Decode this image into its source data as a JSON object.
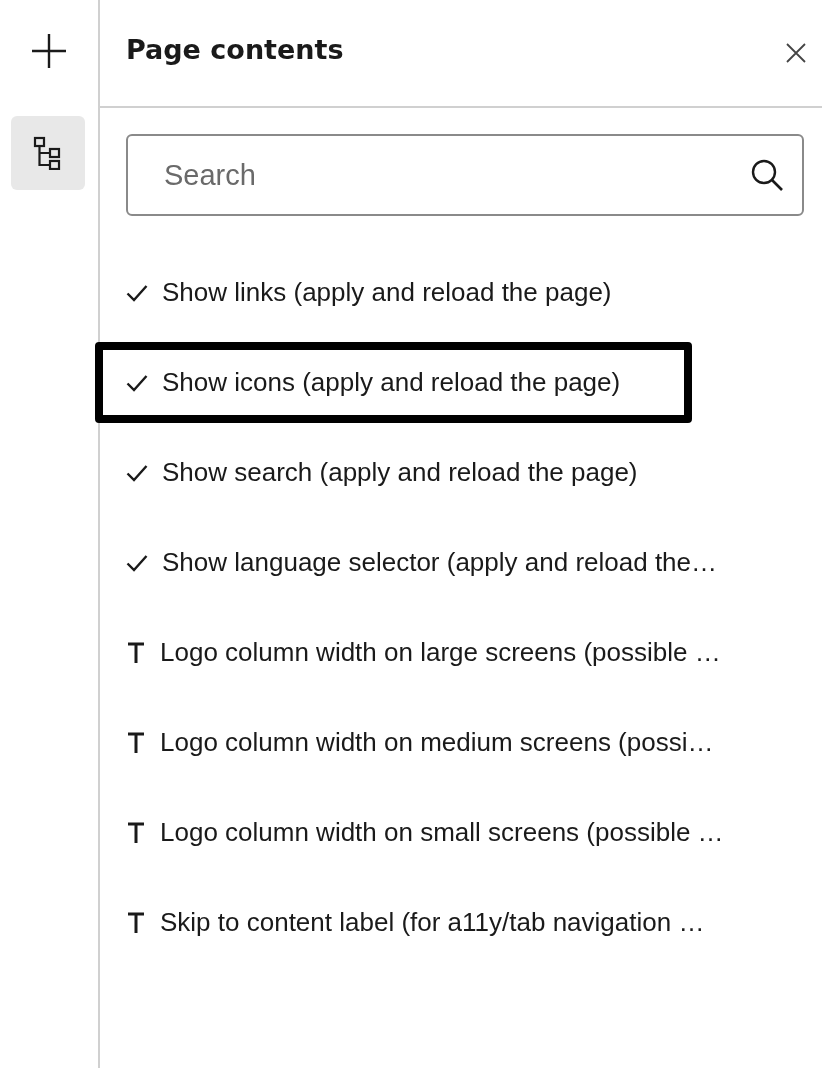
{
  "panel": {
    "title": "Page contents"
  },
  "search": {
    "placeholder": "Search"
  },
  "items": [
    {
      "kind": "check",
      "label": "Show links (apply and reload the page)",
      "selected": false
    },
    {
      "kind": "check",
      "label": "Show icons (apply and reload the page)",
      "selected": true
    },
    {
      "kind": "check",
      "label": "Show search (apply and reload the page)",
      "selected": false
    },
    {
      "kind": "check",
      "label": "Show language selector (apply and reload the…",
      "selected": false
    },
    {
      "kind": "text",
      "label": "Logo column width on large screens (possible …",
      "selected": false
    },
    {
      "kind": "text",
      "label": "Logo column width on medium screens (possi…",
      "selected": false
    },
    {
      "kind": "text",
      "label": "Logo column width on small screens (possible …",
      "selected": false
    },
    {
      "kind": "text",
      "label": "Skip to content label (for a11y/tab navigation …",
      "selected": false
    }
  ]
}
